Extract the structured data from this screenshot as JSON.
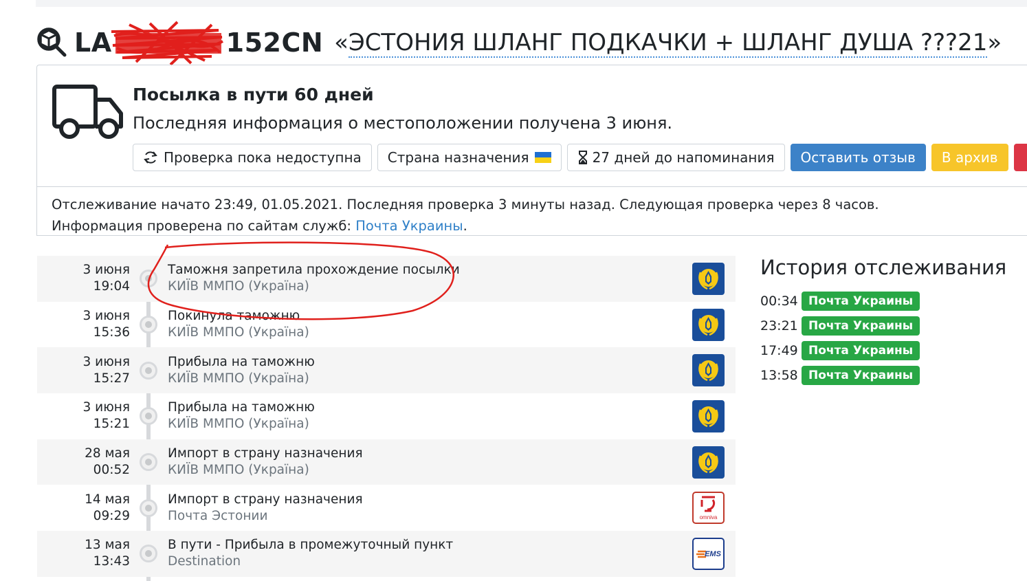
{
  "title": {
    "code_prefix": "LA",
    "code_suffix": "152CN",
    "label_open": "«",
    "label_name": "ЭСТОНИЯ ШЛАНГ ПОДКАЧКИ + ШЛАНГ ДУША ???21",
    "label_close": "»"
  },
  "status": {
    "title": "Посылка в пути 60 дней",
    "subtitle": "Последняя информация о местоположении получена 3 июня.",
    "buttons": {
      "check": "Проверка пока недоступна",
      "country": "Страна назначения",
      "reminder": "27 дней до напоминания",
      "review": "Оставить отзыв",
      "archive": "В архив",
      "close": "×"
    }
  },
  "info": {
    "line1": "Отслеживание начато 23:49, 01.05.2021. Последняя проверка 3 минуты назад. Следующая проверка через 8 часов.",
    "line2_prefix": "Информация проверена по сайтам служб: ",
    "service_link": "Почта Украины",
    "line2_suffix": "."
  },
  "events": [
    {
      "date": "3 июня",
      "time": "19:04",
      "title": "Таможня запретила прохождение посылки",
      "place": "КИЇВ ММПО (Україна)",
      "logo": "ukrposhta-logo"
    },
    {
      "date": "3 июня",
      "time": "15:36",
      "title": "Покинула таможню",
      "place": "КИЇВ ММПО (Україна)",
      "logo": "ukrposhta-logo"
    },
    {
      "date": "3 июня",
      "time": "15:27",
      "title": "Прибыла на таможню",
      "place": "КИЇВ ММПО (Україна)",
      "logo": "ukrposhta-logo"
    },
    {
      "date": "3 июня",
      "time": "15:21",
      "title": "Прибыла на таможню",
      "place": "КИЇВ ММПО (Україна)",
      "logo": "ukrposhta-logo"
    },
    {
      "date": "28 мая",
      "time": "00:52",
      "title": "Импорт в страну назначения",
      "place": "КИЇВ ММПО (Україна)",
      "logo": "ukrposhta-logo"
    },
    {
      "date": "14 мая",
      "time": "09:29",
      "title": "Импорт в страну назначения",
      "place": "Почта Эстонии",
      "logo": "omniva-logo",
      "logo_text": "omniva"
    },
    {
      "date": "13 мая",
      "time": "13:43",
      "title": "В пути - Прибыла в промежуточный пункт",
      "place": "Destination",
      "logo": "ems-logo",
      "logo_text": "EMS"
    }
  ],
  "history": {
    "heading": "История отслеживания",
    "entries": [
      {
        "time": "00:34",
        "service": "Почта Украины"
      },
      {
        "time": "23:21",
        "service": "Почта Украины"
      },
      {
        "time": "17:49",
        "service": "Почта Украины"
      },
      {
        "time": "13:58",
        "service": "Почта Украины"
      }
    ]
  },
  "colors": {
    "accent_blue": "#3c82c8",
    "archive_yellow": "#f7c52a",
    "delete_red": "#dc3545",
    "badge_green": "#28a745",
    "annotation_red": "#e0201c"
  }
}
